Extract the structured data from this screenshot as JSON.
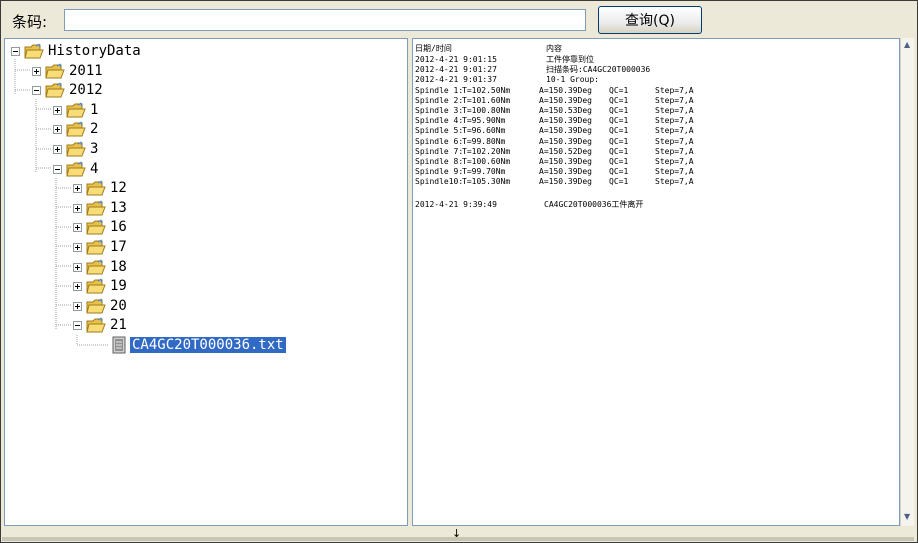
{
  "toolbar": {
    "barcode_label": "条码:",
    "barcode_value": "",
    "query_button": "查询(Q)"
  },
  "tree": {
    "root": "HistoryData",
    "years": [
      {
        "label": "2011",
        "expanded": false
      },
      {
        "label": "2012",
        "expanded": true,
        "months": [
          {
            "label": "1",
            "expanded": false
          },
          {
            "label": "2",
            "expanded": false
          },
          {
            "label": "3",
            "expanded": false
          },
          {
            "label": "4",
            "expanded": true,
            "days": [
              {
                "label": "12",
                "expanded": false
              },
              {
                "label": "13",
                "expanded": false
              },
              {
                "label": "16",
                "expanded": false
              },
              {
                "label": "17",
                "expanded": false
              },
              {
                "label": "18",
                "expanded": false
              },
              {
                "label": "19",
                "expanded": false
              },
              {
                "label": "20",
                "expanded": false
              },
              {
                "label": "21",
                "expanded": true,
                "files": [
                  "CA4GC20T000036.txt"
                ]
              }
            ]
          }
        ]
      }
    ],
    "selected_file": "CA4GC20T000036.txt"
  },
  "log": {
    "headers": {
      "datetime": "日期/时间",
      "content": "内容"
    },
    "events": [
      {
        "time": "2012-4-21 9:01:15",
        "content": "工件停靠到位"
      },
      {
        "time": "2012-4-21 9:01:27",
        "content": "扫描条码:CA4GC20T000036"
      },
      {
        "time": "2012-4-21 9:01:37",
        "content": "10-1 Group:"
      }
    ],
    "spindles": [
      {
        "name": "Spindle 1:",
        "torque": "T=102.50Nm",
        "angle": "A=150.39Deg",
        "qc": "QC=1",
        "step": "Step=7,A"
      },
      {
        "name": "Spindle 2:",
        "torque": "T=101.60Nm",
        "angle": "A=150.39Deg",
        "qc": "QC=1",
        "step": "Step=7,A"
      },
      {
        "name": "Spindle 3:",
        "torque": "T=100.80Nm",
        "angle": "A=150.53Deg",
        "qc": "QC=1",
        "step": "Step=7,A"
      },
      {
        "name": "Spindle 4:",
        "torque": "T=95.90Nm",
        "angle": "A=150.39Deg",
        "qc": "QC=1",
        "step": "Step=7,A"
      },
      {
        "name": "Spindle 5:",
        "torque": "T=96.60Nm",
        "angle": "A=150.39Deg",
        "qc": "QC=1",
        "step": "Step=7,A"
      },
      {
        "name": "Spindle 6:",
        "torque": "T=99.80Nm",
        "angle": "A=150.39Deg",
        "qc": "QC=1",
        "step": "Step=7,A"
      },
      {
        "name": "Spindle 7:",
        "torque": "T=102.20Nm",
        "angle": "A=150.52Deg",
        "qc": "QC=1",
        "step": "Step=7,A"
      },
      {
        "name": "Spindle 8:",
        "torque": "T=100.60Nm",
        "angle": "A=150.39Deg",
        "qc": "QC=1",
        "step": "Step=7,A"
      },
      {
        "name": "Spindle 9:",
        "torque": "T=99.70Nm",
        "angle": "A=150.39Deg",
        "qc": "QC=1",
        "step": "Step=7,A"
      },
      {
        "name": "Spindle10:",
        "torque": "T=105.30Nm",
        "angle": "A=150.39Deg",
        "qc": "QC=1",
        "step": "Step=7,A"
      }
    ],
    "final_event": {
      "time": "2012-4-21 9:39:49",
      "content": "CA4GC20T000036工件离开"
    }
  },
  "icons": {
    "folder": "folder-open-icon",
    "file": "text-file-icon",
    "expand": "plus-box-icon",
    "collapse": "minus-box-icon"
  },
  "colors": {
    "selection": "#316ac5",
    "window_bg": "#ece9d8",
    "border": "#7f9db9"
  }
}
